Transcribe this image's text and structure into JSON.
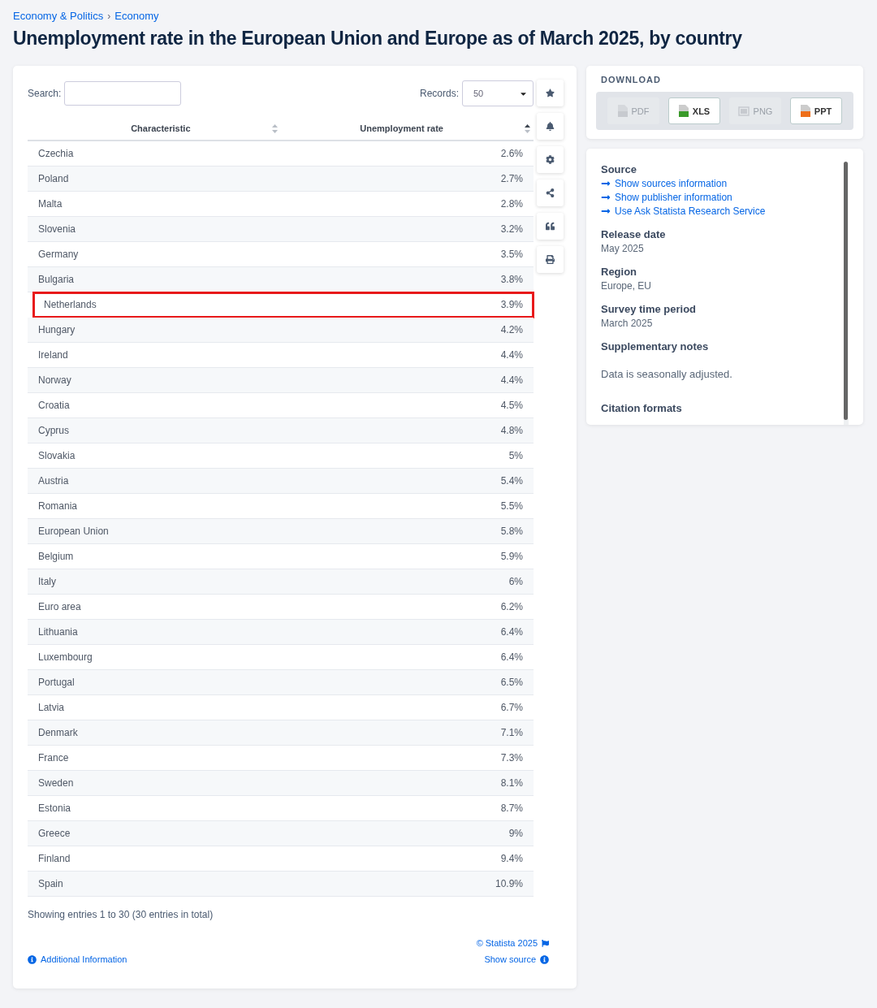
{
  "breadcrumb": [
    "Economy & Politics",
    "Economy"
  ],
  "breadcrumb_separator": "›",
  "title": "Unemployment rate in the European Union and Europe as of March 2025, by country",
  "table_controls": {
    "search_label": "Search:",
    "records_label": "Records:",
    "records_value": "50"
  },
  "columns": [
    {
      "label": "Characteristic",
      "sorted": false
    },
    {
      "label": "Unemployment rate",
      "sorted": true
    }
  ],
  "rows": [
    {
      "country": "Czechia",
      "rate": "2.6%",
      "highlighted": false
    },
    {
      "country": "Poland",
      "rate": "2.7%",
      "highlighted": false
    },
    {
      "country": "Malta",
      "rate": "2.8%",
      "highlighted": false
    },
    {
      "country": "Slovenia",
      "rate": "3.2%",
      "highlighted": false
    },
    {
      "country": "Germany",
      "rate": "3.5%",
      "highlighted": false
    },
    {
      "country": "Bulgaria",
      "rate": "3.8%",
      "highlighted": false
    },
    {
      "country": "Netherlands",
      "rate": "3.9%",
      "highlighted": true
    },
    {
      "country": "Hungary",
      "rate": "4.2%",
      "highlighted": false
    },
    {
      "country": "Ireland",
      "rate": "4.4%",
      "highlighted": false
    },
    {
      "country": "Norway",
      "rate": "4.4%",
      "highlighted": false
    },
    {
      "country": "Croatia",
      "rate": "4.5%",
      "highlighted": false
    },
    {
      "country": "Cyprus",
      "rate": "4.8%",
      "highlighted": false
    },
    {
      "country": "Slovakia",
      "rate": "5%",
      "highlighted": false
    },
    {
      "country": "Austria",
      "rate": "5.4%",
      "highlighted": false
    },
    {
      "country": "Romania",
      "rate": "5.5%",
      "highlighted": false
    },
    {
      "country": "European Union",
      "rate": "5.8%",
      "highlighted": false
    },
    {
      "country": "Belgium",
      "rate": "5.9%",
      "highlighted": false
    },
    {
      "country": "Italy",
      "rate": "6%",
      "highlighted": false
    },
    {
      "country": "Euro area",
      "rate": "6.2%",
      "highlighted": false
    },
    {
      "country": "Lithuania",
      "rate": "6.4%",
      "highlighted": false
    },
    {
      "country": "Luxembourg",
      "rate": "6.4%",
      "highlighted": false
    },
    {
      "country": "Portugal",
      "rate": "6.5%",
      "highlighted": false
    },
    {
      "country": "Latvia",
      "rate": "6.7%",
      "highlighted": false
    },
    {
      "country": "Denmark",
      "rate": "7.1%",
      "highlighted": false
    },
    {
      "country": "France",
      "rate": "7.3%",
      "highlighted": false
    },
    {
      "country": "Sweden",
      "rate": "8.1%",
      "highlighted": false
    },
    {
      "country": "Estonia",
      "rate": "8.7%",
      "highlighted": false
    },
    {
      "country": "Greece",
      "rate": "9%",
      "highlighted": false
    },
    {
      "country": "Finland",
      "rate": "9.4%",
      "highlighted": false
    },
    {
      "country": "Spain",
      "rate": "10.9%",
      "highlighted": false
    }
  ],
  "entries_info": "Showing entries 1 to 30 (30 entries in total)",
  "footer": {
    "additional_info": "Additional Information",
    "copyright": "© Statista 2025",
    "show_source": "Show source"
  },
  "download": {
    "title": "DOWNLOAD",
    "buttons": [
      {
        "label": "PDF",
        "kind": "pdf",
        "disabled": true
      },
      {
        "label": "XLS",
        "kind": "xls",
        "disabled": false
      },
      {
        "label": "PNG",
        "kind": "png",
        "disabled": true
      },
      {
        "label": "PPT",
        "kind": "ppt",
        "disabled": false
      }
    ]
  },
  "details": {
    "source_title": "Source",
    "source_links": [
      "Show sources information",
      "Show publisher information",
      "Use Ask Statista Research Service"
    ],
    "sections": [
      {
        "heading": "Release date",
        "value": "May 2025"
      },
      {
        "heading": "Region",
        "value": "Europe, EU"
      },
      {
        "heading": "Survey time period",
        "value": "March 2025"
      }
    ],
    "notes_heading": "Supplementary notes",
    "notes": "Data is seasonally adjusted.",
    "citation_heading": "Citation formats"
  }
}
